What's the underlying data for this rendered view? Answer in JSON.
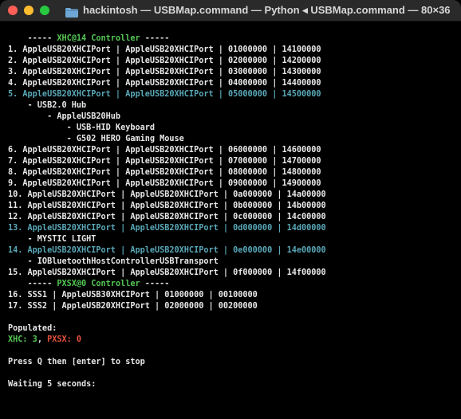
{
  "window": {
    "title": "hackintosh — USBMap.command — Python ◂ USBMap.command — 80×36",
    "colors": {
      "close": "#ff5f57",
      "minimize": "#febc2e",
      "zoom": "#28c840",
      "folder": "#6ea7d6"
    }
  },
  "terminal": {
    "lines": [
      {
        "text": "    ----- ",
        "parts": [
          {
            "t": "    ----- ",
            "c": ""
          },
          {
            "t": "XHC@14 Controller",
            "c": "green"
          },
          {
            "t": " -----",
            "c": ""
          }
        ]
      },
      {
        "parts": [
          {
            "t": "1. AppleUSB20XHCIPort | AppleUSB20XHCIPort | 01000000 | 14100000",
            "c": ""
          }
        ]
      },
      {
        "parts": [
          {
            "t": "2. AppleUSB20XHCIPort | AppleUSB20XHCIPort | 02000000 | 14200000",
            "c": ""
          }
        ]
      },
      {
        "parts": [
          {
            "t": "3. AppleUSB20XHCIPort | AppleUSB20XHCIPort | 03000000 | 14300000",
            "c": ""
          }
        ]
      },
      {
        "parts": [
          {
            "t": "4. AppleUSB20XHCIPort | AppleUSB20XHCIPort | 04000000 | 14400000",
            "c": ""
          }
        ]
      },
      {
        "parts": [
          {
            "t": "5. AppleUSB20XHCIPort | AppleUSB20XHCIPort | 05000000 | 14500000",
            "c": "cyan"
          }
        ]
      },
      {
        "parts": [
          {
            "t": "    - USB2.0 Hub",
            "c": ""
          }
        ]
      },
      {
        "parts": [
          {
            "t": "        - AppleUSB20Hub",
            "c": ""
          }
        ]
      },
      {
        "parts": [
          {
            "t": "            - USB-HID Keyboard",
            "c": ""
          }
        ]
      },
      {
        "parts": [
          {
            "t": "            - G502 HERO Gaming Mouse",
            "c": ""
          }
        ]
      },
      {
        "parts": [
          {
            "t": "6. AppleUSB20XHCIPort | AppleUSB20XHCIPort | 06000000 | 14600000",
            "c": ""
          }
        ]
      },
      {
        "parts": [
          {
            "t": "7. AppleUSB20XHCIPort | AppleUSB20XHCIPort | 07000000 | 14700000",
            "c": ""
          }
        ]
      },
      {
        "parts": [
          {
            "t": "8. AppleUSB20XHCIPort | AppleUSB20XHCIPort | 08000000 | 14800000",
            "c": ""
          }
        ]
      },
      {
        "parts": [
          {
            "t": "9. AppleUSB20XHCIPort | AppleUSB20XHCIPort | 09000000 | 14900000",
            "c": ""
          }
        ]
      },
      {
        "parts": [
          {
            "t": "10. AppleUSB20XHCIPort | AppleUSB20XHCIPort | 0a000000 | 14a00000",
            "c": ""
          }
        ]
      },
      {
        "parts": [
          {
            "t": "11. AppleUSB20XHCIPort | AppleUSB20XHCIPort | 0b000000 | 14b00000",
            "c": ""
          }
        ]
      },
      {
        "parts": [
          {
            "t": "12. AppleUSB20XHCIPort | AppleUSB20XHCIPort | 0c000000 | 14c00000",
            "c": ""
          }
        ]
      },
      {
        "parts": [
          {
            "t": "13. AppleUSB20XHCIPort | AppleUSB20XHCIPort | 0d000000 | 14d00000",
            "c": "cyan"
          }
        ]
      },
      {
        "parts": [
          {
            "t": "    - MYSTIC LIGHT",
            "c": ""
          }
        ]
      },
      {
        "parts": [
          {
            "t": "14. AppleUSB20XHCIPort | AppleUSB20XHCIPort | 0e000000 | 14e00000",
            "c": "cyan"
          }
        ]
      },
      {
        "parts": [
          {
            "t": "    - IOBluetoothHostControllerUSBTransport",
            "c": ""
          }
        ]
      },
      {
        "parts": [
          {
            "t": "15. AppleUSB20XHCIPort | AppleUSB20XHCIPort | 0f000000 | 14f00000",
            "c": ""
          }
        ]
      },
      {
        "parts": [
          {
            "t": "    ----- ",
            "c": ""
          },
          {
            "t": "PXSX@0 Controller",
            "c": "green"
          },
          {
            "t": " -----",
            "c": ""
          }
        ]
      },
      {
        "parts": [
          {
            "t": "16. SSS1 | AppleUSB30XHCIPort | 01000000 | 00100000",
            "c": ""
          }
        ]
      },
      {
        "parts": [
          {
            "t": "17. SSS2 | AppleUSB20XHCIPort | 02000000 | 00200000",
            "c": ""
          }
        ]
      },
      {
        "parts": [
          {
            "t": "",
            "c": ""
          }
        ]
      },
      {
        "parts": [
          {
            "t": "Populated:",
            "c": ""
          }
        ]
      },
      {
        "parts": [
          {
            "t": "XHC: 3",
            "c": "green"
          },
          {
            "t": ", ",
            "c": ""
          },
          {
            "t": "PXSX: 0",
            "c": "red"
          }
        ]
      },
      {
        "parts": [
          {
            "t": "",
            "c": ""
          }
        ]
      },
      {
        "parts": [
          {
            "t": "Press Q then [enter] to stop",
            "c": ""
          }
        ]
      },
      {
        "parts": [
          {
            "t": "",
            "c": ""
          }
        ]
      },
      {
        "parts": [
          {
            "t": "Waiting 5 seconds:",
            "c": ""
          }
        ]
      }
    ]
  }
}
